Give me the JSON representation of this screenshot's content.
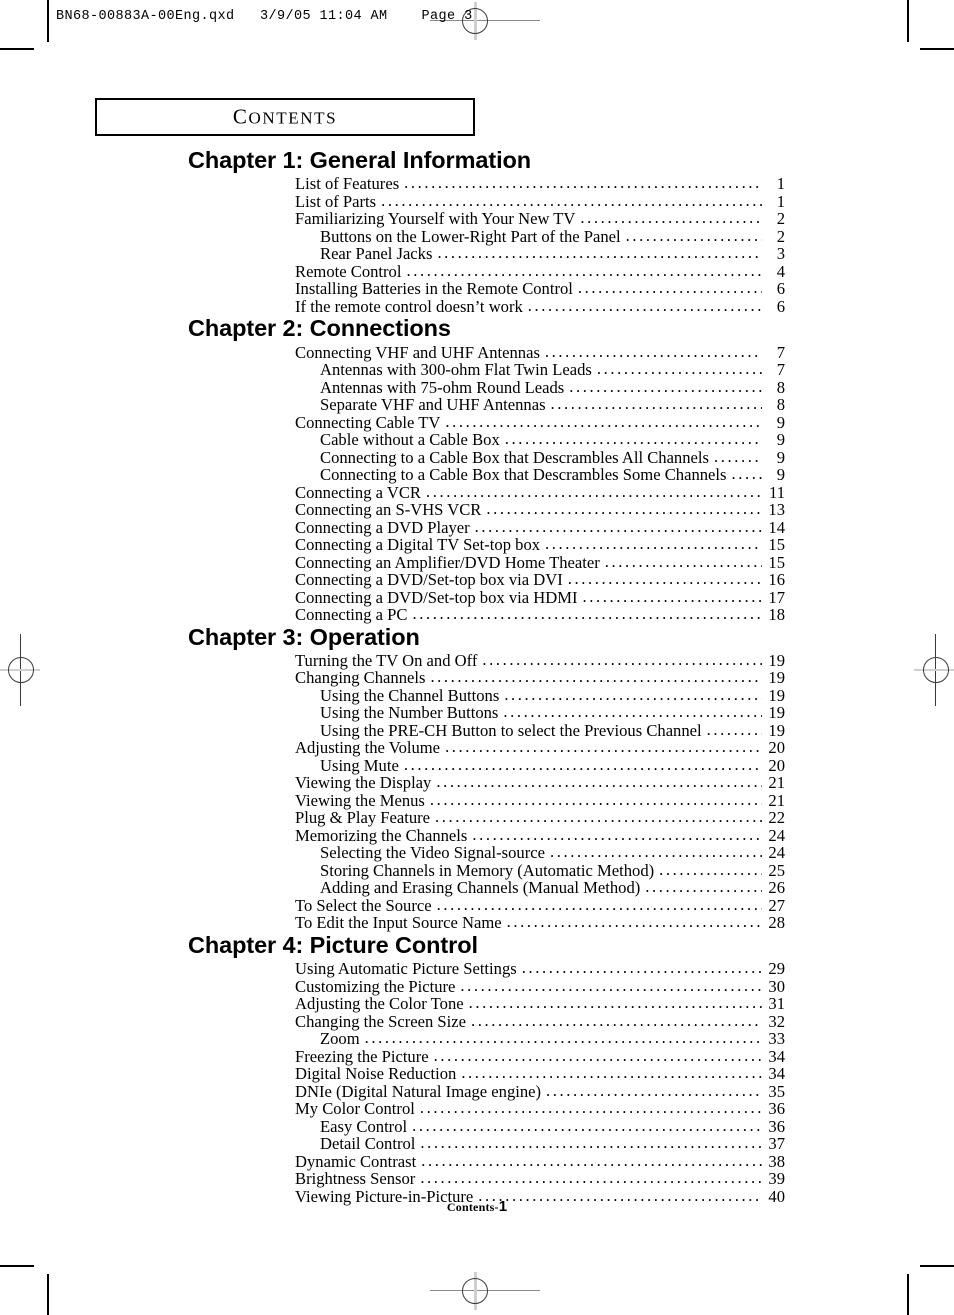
{
  "print_marks": {
    "file_stamp": "BN68-00883A-00Eng.qxd   3/9/05 11:04 AM    Page 3"
  },
  "header": {
    "contents_title_first_letter": "C",
    "contents_title_rest": "ONTENTS"
  },
  "footer": {
    "label": "Contents-",
    "page_number": "1"
  },
  "toc": {
    "chapters": [
      {
        "heading": "Chapter 1: General Information",
        "entries": [
          {
            "level": 1,
            "label": "List of Features",
            "page": "1"
          },
          {
            "level": 1,
            "label": "List of Parts",
            "page": "1"
          },
          {
            "level": 1,
            "label": "Familiarizing Yourself with Your New TV",
            "page": "2"
          },
          {
            "level": 2,
            "label": "Buttons on the Lower-Right Part of the Panel",
            "page": "2"
          },
          {
            "level": 2,
            "label": "Rear Panel Jacks",
            "page": "3"
          },
          {
            "level": 1,
            "label": "Remote Control",
            "page": "4"
          },
          {
            "level": 1,
            "label": "Installing Batteries in the Remote Control",
            "page": "6"
          },
          {
            "level": 1,
            "label": "If the remote control doesn’t work",
            "page": "6"
          }
        ]
      },
      {
        "heading": "Chapter 2: Connections",
        "entries": [
          {
            "level": 1,
            "label": "Connecting VHF and UHF Antennas",
            "page": "7"
          },
          {
            "level": 2,
            "label": "Antennas with 300-ohm Flat Twin Leads",
            "page": "7"
          },
          {
            "level": 2,
            "label": "Antennas with 75-ohm Round Leads",
            "page": "8"
          },
          {
            "level": 2,
            "label": "Separate VHF and UHF Antennas",
            "page": "8"
          },
          {
            "level": 1,
            "label": "Connecting Cable TV",
            "page": "9"
          },
          {
            "level": 2,
            "label": "Cable without a Cable Box",
            "page": "9"
          },
          {
            "level": 2,
            "label": "Connecting to a Cable Box that Descrambles All Channels",
            "page": "9"
          },
          {
            "level": 2,
            "label": "Connecting to a Cable Box that Descrambles Some Channels",
            "page": "9"
          },
          {
            "level": 1,
            "label": "Connecting a VCR",
            "page": "11"
          },
          {
            "level": 1,
            "label": "Connecting an S-VHS VCR",
            "page": "13"
          },
          {
            "level": 1,
            "label": "Connecting a DVD Player",
            "page": "14"
          },
          {
            "level": 1,
            "label": "Connecting a Digital TV Set-top box",
            "page": "15"
          },
          {
            "level": 1,
            "label": "Connecting an Amplifier/DVD Home Theater",
            "page": "15"
          },
          {
            "level": 1,
            "label": "Connecting a DVD/Set-top box via DVI",
            "page": "16"
          },
          {
            "level": 1,
            "label": "Connecting a DVD/Set-top box via HDMI",
            "page": "17"
          },
          {
            "level": 1,
            "label": "Connecting a PC",
            "page": "18"
          }
        ]
      },
      {
        "heading": "Chapter 3: Operation",
        "entries": [
          {
            "level": 1,
            "label": "Turning the TV On and Off",
            "page": "19"
          },
          {
            "level": 1,
            "label": "Changing Channels",
            "page": "19"
          },
          {
            "level": 2,
            "label": "Using the Channel Buttons",
            "page": "19"
          },
          {
            "level": 2,
            "label": "Using the Number Buttons",
            "page": "19"
          },
          {
            "level": 2,
            "label": "Using the PRE-CH Button to select the Previous Channel",
            "page": "19"
          },
          {
            "level": 1,
            "label": "Adjusting the Volume",
            "page": "20"
          },
          {
            "level": 2,
            "label": "Using Mute",
            "page": "20"
          },
          {
            "level": 1,
            "label": "Viewing the Display",
            "page": "21"
          },
          {
            "level": 1,
            "label": "Viewing the Menus",
            "page": "21"
          },
          {
            "level": 1,
            "label": "Plug & Play Feature",
            "page": "22"
          },
          {
            "level": 1,
            "label": "Memorizing the Channels",
            "page": "24"
          },
          {
            "level": 2,
            "label": "Selecting the Video Signal-source",
            "page": "24"
          },
          {
            "level": 2,
            "label": "Storing Channels in Memory (Automatic Method)",
            "page": "25"
          },
          {
            "level": 2,
            "label": "Adding and Erasing Channels (Manual Method)",
            "page": "26"
          },
          {
            "level": 1,
            "label": "To Select the Source",
            "page": "27"
          },
          {
            "level": 1,
            "label": "To Edit the Input Source Name",
            "page": "28"
          }
        ]
      },
      {
        "heading": "Chapter 4: Picture Control",
        "entries": [
          {
            "level": 1,
            "label": "Using Automatic Picture Settings",
            "page": "29"
          },
          {
            "level": 1,
            "label": "Customizing the Picture",
            "page": "30"
          },
          {
            "level": 1,
            "label": "Adjusting the Color Tone",
            "page": "31"
          },
          {
            "level": 1,
            "label": "Changing the Screen Size",
            "page": "32"
          },
          {
            "level": 2,
            "label": "Zoom",
            "page": "33"
          },
          {
            "level": 1,
            "label": "Freezing the Picture",
            "page": "34"
          },
          {
            "level": 1,
            "label": "Digital Noise Reduction",
            "page": "34"
          },
          {
            "level": 1,
            "label": "DNIe (Digital Natural Image engine)",
            "page": "35"
          },
          {
            "level": 1,
            "label": "My Color Control",
            "page": "36"
          },
          {
            "level": 2,
            "label": "Easy Control",
            "page": "36"
          },
          {
            "level": 2,
            "label": "Detail Control",
            "page": "37"
          },
          {
            "level": 1,
            "label": "Dynamic Contrast",
            "page": "38"
          },
          {
            "level": 1,
            "label": "Brightness Sensor",
            "page": "39"
          },
          {
            "level": 1,
            "label": "Viewing Picture-in-Picture",
            "page": "40"
          }
        ]
      }
    ]
  }
}
